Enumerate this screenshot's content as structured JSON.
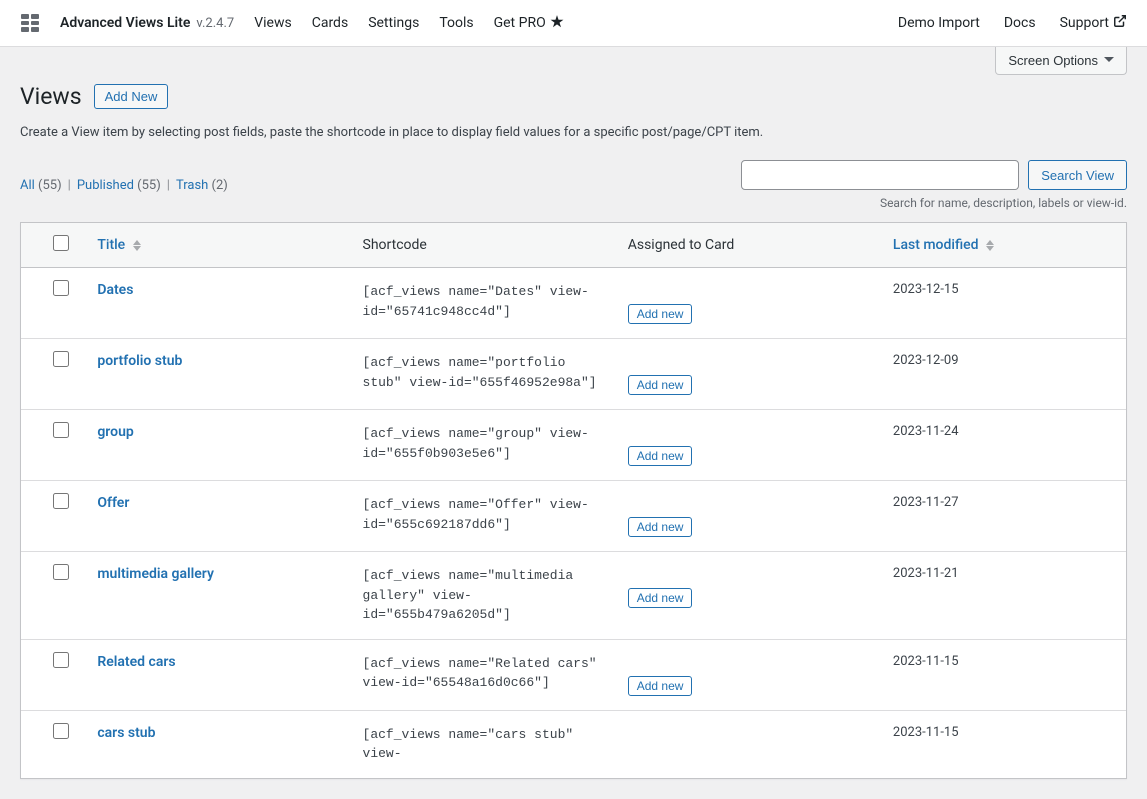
{
  "toolbar": {
    "app_title": "Advanced Views Lite",
    "app_version": "v.2.4.7",
    "nav": {
      "views": "Views",
      "cards": "Cards",
      "settings": "Settings",
      "tools": "Tools",
      "get_pro": "Get PRO"
    },
    "right_nav": {
      "demo_import": "Demo Import",
      "docs": "Docs",
      "support": "Support"
    }
  },
  "screen_options": "Screen Options",
  "page": {
    "title": "Views",
    "add_new": "Add New",
    "description": "Create a View item by selecting post fields, paste the shortcode in place to display field values for a specific post/page/CPT item."
  },
  "filters": {
    "all_label": "All",
    "all_count": "(55)",
    "published_label": "Published",
    "published_count": "(55)",
    "trash_label": "Trash",
    "trash_count": "(2)"
  },
  "search": {
    "button": "Search View",
    "hint": "Search for name, description, labels or view-id."
  },
  "table": {
    "headers": {
      "title": "Title",
      "shortcode": "Shortcode",
      "assigned": "Assigned to Card",
      "modified": "Last modified"
    },
    "add_new_card": "Add new",
    "rows": [
      {
        "title": "Dates",
        "shortcode": "[acf_views name=\"Dates\" view-id=\"65741c948cc4d\"]",
        "modified": "2023-12-15"
      },
      {
        "title": "portfolio stub",
        "shortcode": "[acf_views name=\"portfolio stub\" view-id=\"655f46952e98a\"]",
        "modified": "2023-12-09"
      },
      {
        "title": "group",
        "shortcode": "[acf_views name=\"group\" view-id=\"655f0b903e5e6\"]",
        "modified": "2023-11-24"
      },
      {
        "title": "Offer",
        "shortcode": "[acf_views name=\"Offer\" view-id=\"655c692187dd6\"]",
        "modified": "2023-11-27"
      },
      {
        "title": "multimedia gallery",
        "shortcode": "[acf_views name=\"multimedia gallery\" view-id=\"655b479a6205d\"]",
        "modified": "2023-11-21"
      },
      {
        "title": "Related cars",
        "shortcode": "[acf_views name=\"Related cars\" view-id=\"65548a16d0c66\"]",
        "modified": "2023-11-15"
      },
      {
        "title": "cars stub",
        "shortcode": "[acf_views name=\"cars stub\" view-",
        "modified": "2023-11-15",
        "partial": true
      }
    ]
  }
}
